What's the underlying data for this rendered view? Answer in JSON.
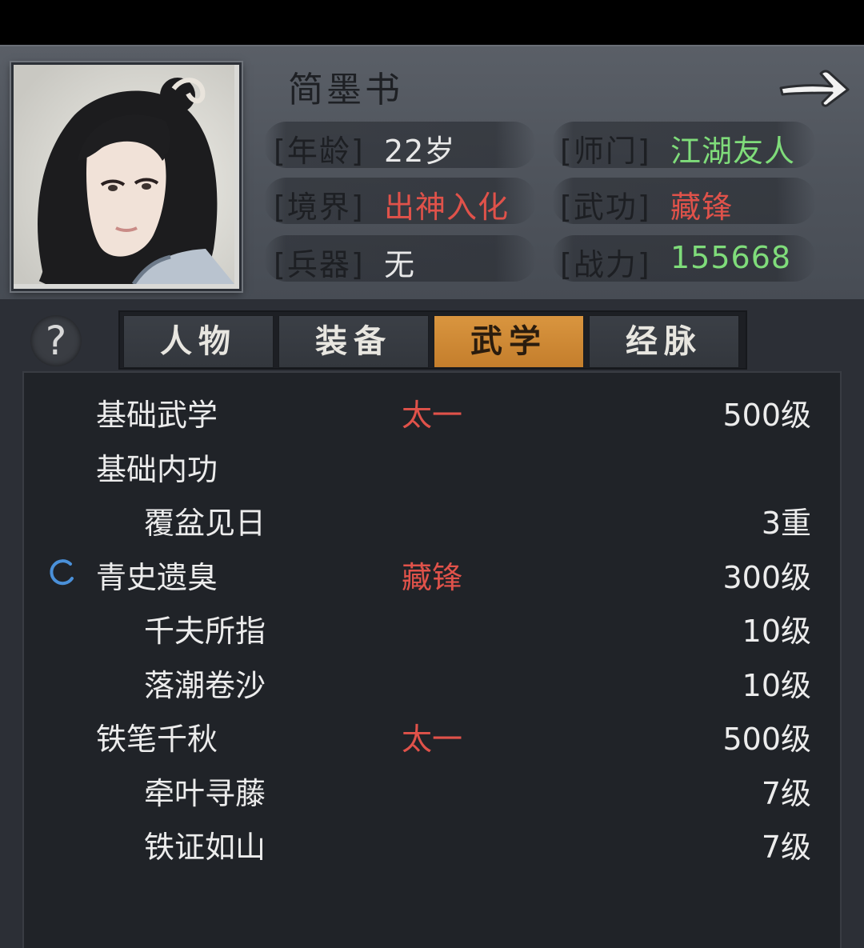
{
  "character": {
    "name": "简墨书",
    "stats": [
      {
        "label": "[年龄]",
        "value": "22岁",
        "color": "white"
      },
      {
        "label": "[师门]",
        "value": "江湖友人",
        "color": "green"
      },
      {
        "label": "[境界]",
        "value": "出神入化",
        "color": "red"
      },
      {
        "label": "[武功]",
        "value": "藏锋",
        "color": "red"
      },
      {
        "label": "[兵器]",
        "value": "无",
        "color": "white"
      },
      {
        "label": "[战力]",
        "value": "155668",
        "color": "green"
      }
    ]
  },
  "help": {
    "label": "?"
  },
  "tabs": [
    {
      "label": "人物",
      "active": false
    },
    {
      "label": "装备",
      "active": false
    },
    {
      "label": "武学",
      "active": true
    },
    {
      "label": "经脉",
      "active": false
    }
  ],
  "skills": [
    {
      "name": "基础武学",
      "tag": "太一",
      "level": "500级",
      "indent": false,
      "spinner": false
    },
    {
      "name": "基础内功",
      "tag": "",
      "level": "",
      "indent": false,
      "spinner": false
    },
    {
      "name": "覆盆见日",
      "tag": "",
      "level": "3重",
      "indent": true,
      "spinner": false
    },
    {
      "name": "青史遗臭",
      "tag": "藏锋",
      "level": "300级",
      "indent": false,
      "spinner": true
    },
    {
      "name": "千夫所指",
      "tag": "",
      "level": "10级",
      "indent": true,
      "spinner": false
    },
    {
      "name": "落潮卷沙",
      "tag": "",
      "level": "10级",
      "indent": true,
      "spinner": false
    },
    {
      "name": "铁笔千秋",
      "tag": "太一",
      "level": "500级",
      "indent": false,
      "spinner": false
    },
    {
      "name": "牵叶寻藤",
      "tag": "",
      "level": "7级",
      "indent": true,
      "spinner": false
    },
    {
      "name": "铁证如山",
      "tag": "",
      "level": "7级",
      "indent": true,
      "spinner": false
    }
  ],
  "colors": {
    "accent": "#c98530",
    "red": "#e0524a",
    "green": "#7fdc7a",
    "spinner": "#4a90d9"
  },
  "icons": {
    "next": "right-arrow-icon",
    "loading": "loading-spinner-icon"
  }
}
